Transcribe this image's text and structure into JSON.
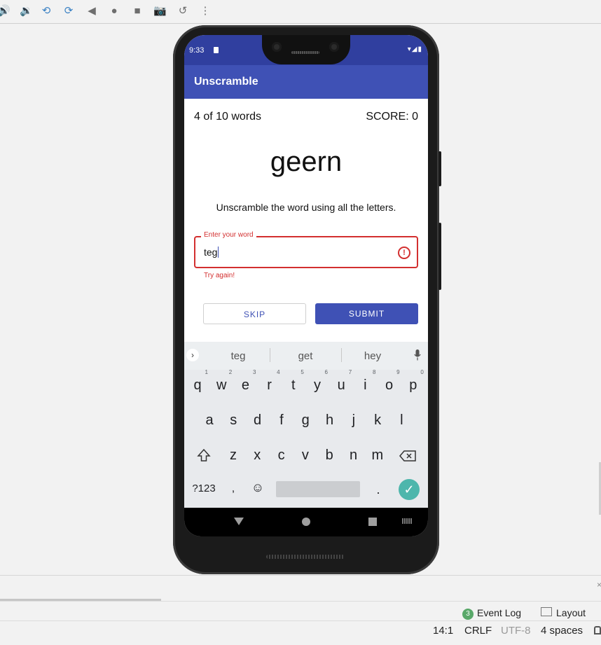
{
  "toolbar": {
    "icons": [
      "volume-up-icon",
      "volume-down-icon",
      "rotate-left-icon",
      "rotate-right-icon",
      "back-icon",
      "home-icon",
      "overview-icon",
      "camera-icon",
      "replay-icon",
      "more-icon"
    ]
  },
  "status": {
    "time": "9:33"
  },
  "app": {
    "title": "Unscramble"
  },
  "game": {
    "word_count": "4 of 10 words",
    "score": "SCORE: 0",
    "scrambled_word": "geern",
    "instructions": "Unscramble the word using all the letters."
  },
  "input": {
    "label": "Enter your word",
    "value": "teg",
    "error": "Try again!"
  },
  "buttons": {
    "skip": "SKIP",
    "submit": "SUBMIT"
  },
  "keyboard": {
    "suggestions": [
      "teg",
      "get",
      "hey"
    ],
    "row1": [
      "q",
      "w",
      "e",
      "r",
      "t",
      "y",
      "u",
      "i",
      "o",
      "p"
    ],
    "row1_hints": [
      "1",
      "2",
      "3",
      "4",
      "5",
      "6",
      "7",
      "8",
      "9",
      "0"
    ],
    "row2": [
      "a",
      "s",
      "d",
      "f",
      "g",
      "h",
      "j",
      "k",
      "l"
    ],
    "row3": [
      "z",
      "x",
      "c",
      "v",
      "b",
      "n",
      "m"
    ],
    "symbols_key": "?123",
    "comma_key": ",",
    "period_key": ".",
    "emoji_key": "☺"
  },
  "ide": {
    "event_log_count": "3",
    "event_log": "Event Log",
    "layout_inspector": "Layout Ins",
    "cursor_pos": "14:1",
    "line_sep": "CRLF",
    "encoding": "UTF-8",
    "indent": "4 spaces"
  }
}
